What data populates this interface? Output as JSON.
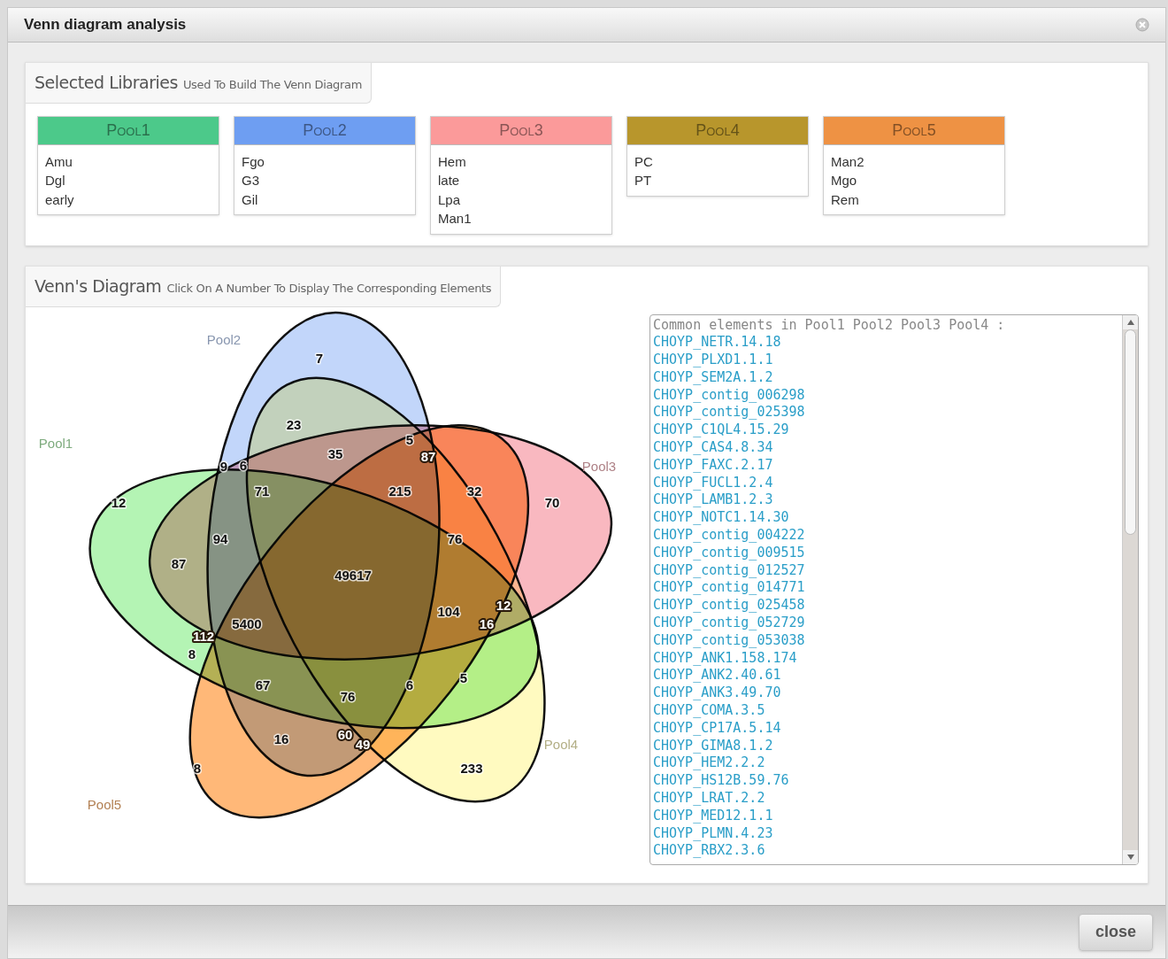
{
  "window": {
    "title": "Venn diagram analysis"
  },
  "libraries": {
    "title": "Selected Libraries",
    "subtitle": "Used To Build The Venn Diagram",
    "pools": [
      {
        "name": "Pool1",
        "color": "#4cc98a",
        "items": [
          "Amu",
          "Dgl",
          "early"
        ]
      },
      {
        "name": "Pool2",
        "color": "#6e9ef2",
        "items": [
          "Fgo",
          "G3",
          "Gil"
        ]
      },
      {
        "name": "Pool3",
        "color": "#fb9a9a",
        "items": [
          "Hem",
          "late",
          "Lpa",
          "Man1"
        ]
      },
      {
        "name": "Pool4",
        "color": "#b8962c",
        "items": [
          "PC",
          "PT"
        ]
      },
      {
        "name": "Pool5",
        "color": "#ee9244",
        "items": [
          "Man2",
          "Mgo",
          "Rem"
        ]
      }
    ]
  },
  "venn": {
    "title": "Venn's Diagram",
    "subtitle": "Click On A Number To Display The Corresponding Elements",
    "sets": [
      {
        "name": "Pool1",
        "color": "#b4f4b4"
      },
      {
        "name": "Pool2",
        "color": "#c2d6fa"
      },
      {
        "name": "Pool3",
        "color": "#f9b8c0"
      },
      {
        "name": "Pool4",
        "color": "#fffac0"
      },
      {
        "name": "Pool5",
        "color": "#ffb878"
      }
    ],
    "counts": [
      "7",
      "23",
      "5",
      "87",
      "35",
      "9",
      "6",
      "71",
      "215",
      "32",
      "70",
      "12",
      "94",
      "76",
      "87",
      "49617",
      "12",
      "104",
      "16",
      "5400",
      "112",
      "8",
      "67",
      "76",
      "6",
      "5",
      "16",
      "60",
      "49",
      "8",
      "233"
    ],
    "elements": {
      "heading": "Common elements in Pool1 Pool2 Pool3 Pool4 :",
      "items": [
        "CHOYP_NETR.14.18",
        "CHOYP_PLXD1.1.1",
        "CHOYP_SEM2A.1.2",
        "CHOYP_contig_006298",
        "CHOYP_contig_025398",
        "CHOYP_C1QL4.15.29",
        "CHOYP_CAS4.8.34",
        "CHOYP_FAXC.2.17",
        "CHOYP_FUCL1.2.4",
        "CHOYP_LAMB1.2.3",
        "CHOYP_NOTC1.14.30",
        "CHOYP_contig_004222",
        "CHOYP_contig_009515",
        "CHOYP_contig_012527",
        "CHOYP_contig_014771",
        "CHOYP_contig_025458",
        "CHOYP_contig_052729",
        "CHOYP_contig_053038",
        "CHOYP_ANK1.158.174",
        "CHOYP_ANK2.40.61",
        "CHOYP_ANK3.49.70",
        "CHOYP_COMA.3.5",
        "CHOYP_CP17A.5.14",
        "CHOYP_GIMA8.1.2",
        "CHOYP_HEM2.2.2",
        "CHOYP_HS12B.59.76",
        "CHOYP_LRAT.2.2",
        "CHOYP_MED12.1.1",
        "CHOYP_PLMN.4.23",
        "CHOYP_RBX2.3.6"
      ]
    }
  },
  "footer": {
    "close_button": "close"
  }
}
